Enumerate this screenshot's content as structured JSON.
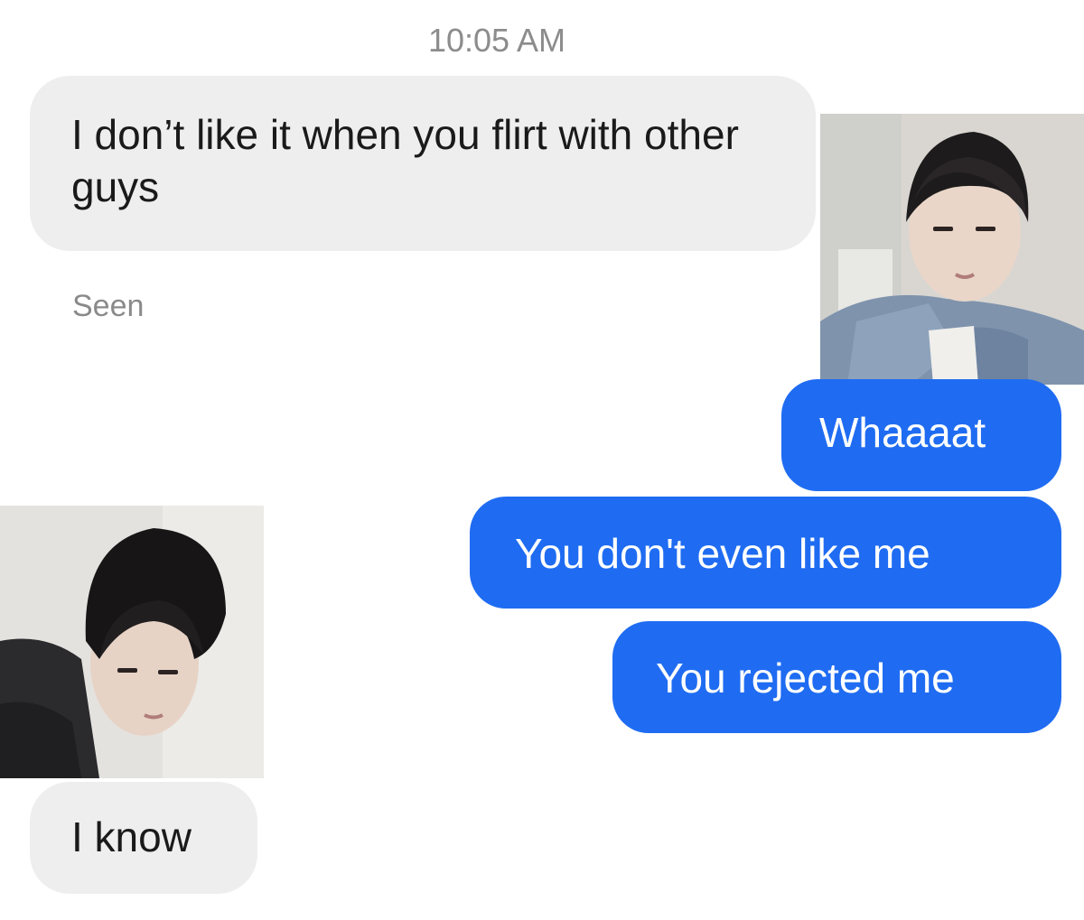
{
  "conversation": {
    "timestamp": "10:05 AM",
    "seen_label": "Seen",
    "messages": [
      {
        "sender": "other",
        "text": "I don’t like it when you flirt with other guys"
      },
      {
        "sender": "me",
        "text": "Whaaaat"
      },
      {
        "sender": "me",
        "text": "You don't even like me"
      },
      {
        "sender": "me",
        "text": "You rejected me"
      },
      {
        "sender": "other",
        "text": "I know"
      }
    ]
  },
  "colors": {
    "incoming_bubble": "#eeeeee",
    "outgoing_bubble": "#1f6cf2",
    "timestamp_text": "#8c8c8c"
  },
  "images": [
    {
      "name": "photo-top-right",
      "description_icon": "person-photo"
    },
    {
      "name": "photo-bottom-left",
      "description_icon": "person-photo"
    }
  ]
}
